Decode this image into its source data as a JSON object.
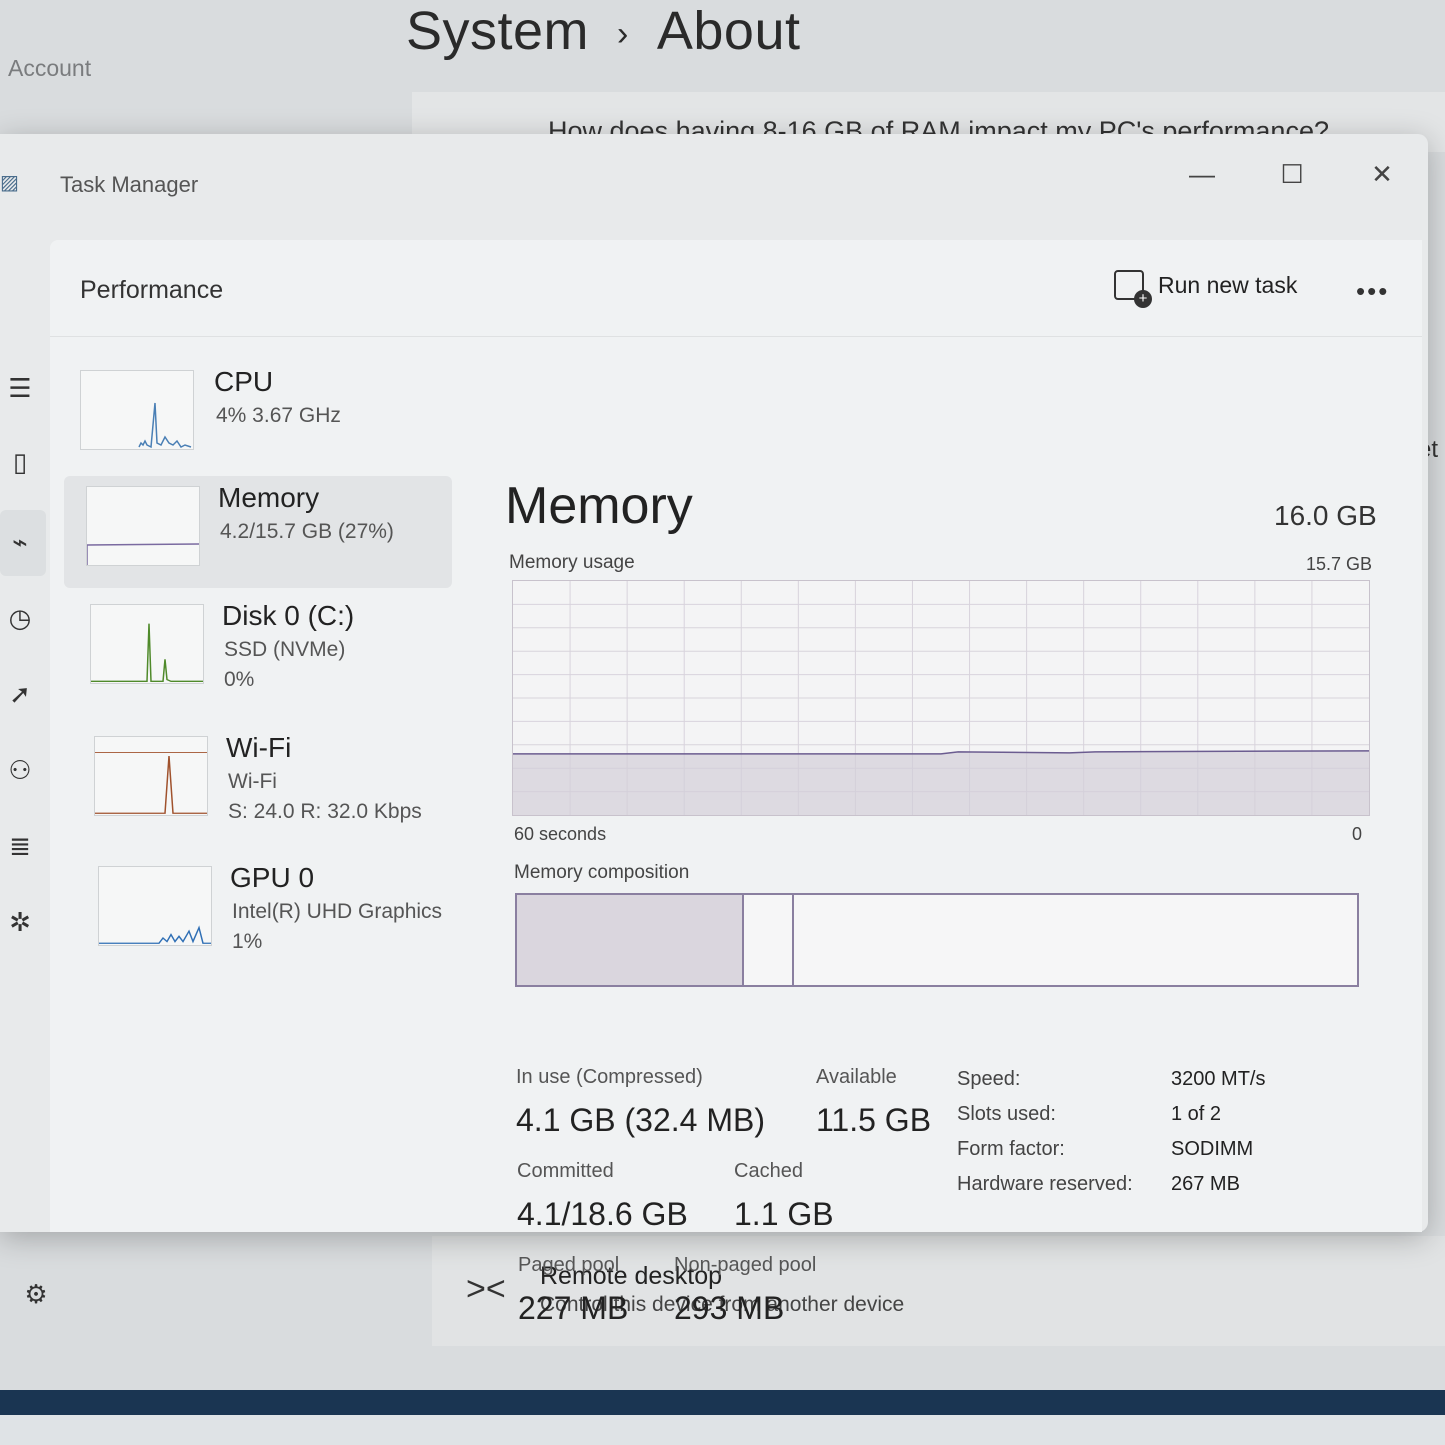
{
  "settings_bg": {
    "breadcrumb_parent": "System",
    "breadcrumb_separator": "›",
    "breadcrumb_current": "About",
    "nav_account": "Account",
    "question": "How does having 8-16 GB of RAM impact my PC's performance?",
    "cut_text": "et",
    "remote_title": "Remote desktop",
    "remote_subtitle": "Control this device from another device"
  },
  "window": {
    "title": "Task Manager",
    "minimize": "—",
    "maximize": "☐",
    "close": "✕"
  },
  "header": {
    "page_title": "Performance",
    "run_new_task": "Run new task",
    "more": "•••"
  },
  "nav_icons": [
    "hamburger-icon",
    "processes-icon",
    "performance-icon",
    "app-history-icon",
    "startup-icon",
    "users-icon",
    "details-icon",
    "services-icon",
    "settings-icon"
  ],
  "perf_list": [
    {
      "name": "CPU",
      "line1": "4%  3.67 GHz",
      "line2": "",
      "color": "#4a7fb5"
    },
    {
      "name": "Memory",
      "line1": "4.2/15.7 GB (27%)",
      "line2": "",
      "color": "#7a6aa0"
    },
    {
      "name": "Disk 0 (C:)",
      "line1": "SSD (NVMe)",
      "line2": "0%",
      "color": "#4f8a2a"
    },
    {
      "name": "Wi-Fi",
      "line1": "Wi-Fi",
      "line2": "S: 24.0  R: 32.0 Kbps",
      "color": "#a0522d"
    },
    {
      "name": "GPU 0",
      "line1": "Intel(R) UHD Graphics",
      "line2": "1%",
      "color": "#2f6fb5"
    }
  ],
  "memory": {
    "title": "Memory",
    "total": "16.0 GB",
    "usage_label": "Memory usage",
    "usage_max": "15.7 GB",
    "axis_left": "60 seconds",
    "axis_right": "0",
    "composition_label": "Memory composition",
    "usage_fraction": 0.27,
    "composition": {
      "in_use_fraction": 0.27,
      "standby_end_fraction": 0.33
    },
    "stats": {
      "in_use_label": "In use (Compressed)",
      "in_use_value": "4.1 GB (32.4 MB)",
      "available_label": "Available",
      "available_value": "11.5 GB",
      "committed_label": "Committed",
      "committed_value": "4.1/18.6 GB",
      "cached_label": "Cached",
      "cached_value": "1.1 GB",
      "paged_label": "Paged pool",
      "paged_value": "227 MB",
      "nonpaged_label": "Non-paged pool",
      "nonpaged_value": "293 MB"
    },
    "details": [
      {
        "key": "Speed:",
        "value": "3200 MT/s"
      },
      {
        "key": "Slots used:",
        "value": "1 of 2"
      },
      {
        "key": "Form factor:",
        "value": "SODIMM"
      },
      {
        "key": "Hardware reserved:",
        "value": "267 MB"
      }
    ]
  }
}
